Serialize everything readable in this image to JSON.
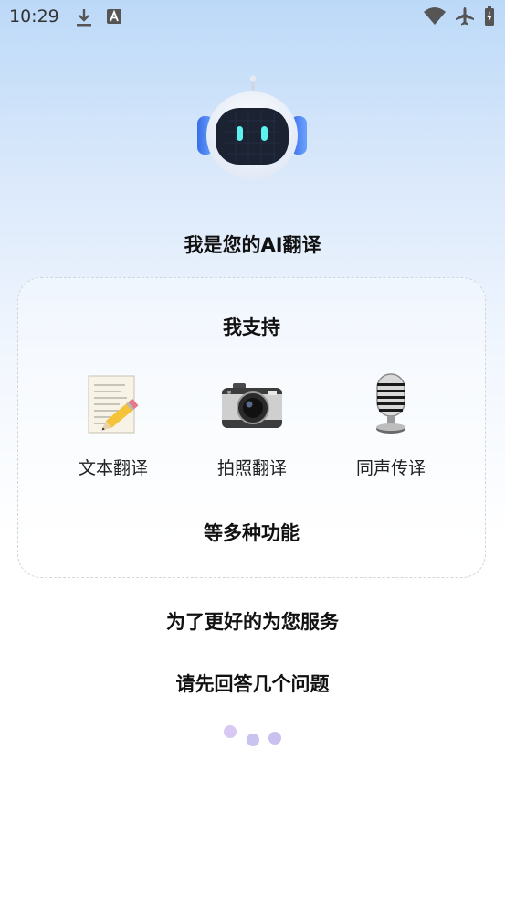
{
  "status_bar": {
    "time": "10:29",
    "left_icons": [
      "download-icon",
      "a-notification-icon"
    ],
    "right_icons": [
      "wifi-icon",
      "airplane-mode-icon",
      "battery-icon"
    ]
  },
  "hero": {
    "mascot": "robot-mascot-icon",
    "title": "我是您的AI翻译"
  },
  "features_card": {
    "heading": "我支持",
    "items": [
      {
        "label": "文本翻译",
        "icon": "memo-pencil-icon"
      },
      {
        "label": "拍照翻译",
        "icon": "camera-icon"
      },
      {
        "label": "同声传译",
        "icon": "microphone-icon"
      }
    ],
    "footer": "等多种功能"
  },
  "prompt": {
    "line1": "为了更好的为您服务",
    "line2": "请先回答几个问题"
  },
  "loading": {
    "dot_colors": [
      "#d7c9f3",
      "#c9c3f0",
      "#cbc1f1"
    ]
  }
}
